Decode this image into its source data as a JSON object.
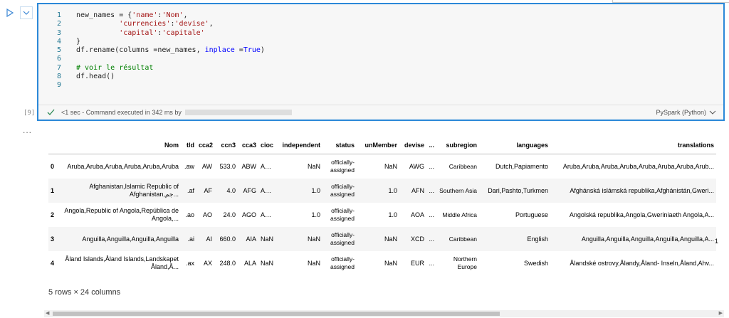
{
  "cell": {
    "exec_count": "[9]",
    "status_text": "<1 sec - Command executed in 342 ms by",
    "kernel": "PySpark (Python)",
    "more": "..."
  },
  "code": [
    [
      {
        "c": "p",
        "t": "new_names = {"
      },
      {
        "c": "s",
        "t": "'name'"
      },
      {
        "c": "p",
        "t": ":"
      },
      {
        "c": "s",
        "t": "'Nom'"
      },
      {
        "c": "p",
        "t": ","
      }
    ],
    [
      {
        "c": "p",
        "t": "          "
      },
      {
        "c": "s",
        "t": "'currencies'"
      },
      {
        "c": "p",
        "t": ":"
      },
      {
        "c": "s",
        "t": "'devise'"
      },
      {
        "c": "p",
        "t": ","
      }
    ],
    [
      {
        "c": "p",
        "t": "          "
      },
      {
        "c": "s",
        "t": "'capital'"
      },
      {
        "c": "p",
        "t": ":"
      },
      {
        "c": "s",
        "t": "'capitale'"
      }
    ],
    [
      {
        "c": "p",
        "t": "}"
      }
    ],
    [
      {
        "c": "p",
        "t": "df.rename(columns =new_names, "
      },
      {
        "c": "k",
        "t": "inplace"
      },
      {
        "c": "p",
        "t": " ="
      },
      {
        "c": "k",
        "t": "True"
      },
      {
        "c": "p",
        "t": ")"
      }
    ],
    [],
    [
      {
        "c": "m",
        "t": "# voir le résultat"
      }
    ],
    [
      {
        "c": "p",
        "t": "df.head()"
      }
    ],
    []
  ],
  "table": {
    "columns": [
      "",
      "Nom",
      "tld",
      "cca2",
      "ccn3",
      "cca3",
      "cioc",
      "independent",
      "status",
      "unMember",
      "devise",
      "...",
      "subregion",
      "languages",
      "translations"
    ],
    "rows": [
      [
        "0",
        "Aruba,Aruba,Aruba,Aruba,Aruba,Aruba",
        ".aw",
        "AW",
        "533.0",
        "ABW",
        "ARU",
        "NaN",
        "officially-assigned",
        "NaN",
        "AWG",
        "...",
        "Caribbean",
        "Dutch,Papiamento",
        "Aruba,Aruba,Aruba,Aruba,Aruba,Aruba,Aruba,Arub..."
      ],
      [
        "1",
        "Afghanistan,Islamic Republic of Afghanistan,جم...",
        ".af",
        "AF",
        "4.0",
        "AFG",
        "AFG",
        "1.0",
        "officially-assigned",
        "1.0",
        "AFN",
        "...",
        "Southern Asia",
        "Dari,Pashto,Turkmen",
        "Afghánská islámská republika,Afghánistán,Gweri..."
      ],
      [
        "2",
        "Angola,Republic of Angola,República de Angola,...",
        ".ao",
        "AO",
        "24.0",
        "AGO",
        "ANG",
        "1.0",
        "officially-assigned",
        "1.0",
        "AOA",
        "...",
        "Middle Africa",
        "Portuguese",
        "Angolská republika,Angola,Gweriniaeth Angola,A..."
      ],
      [
        "3",
        "Anguilla,Anguilla,Anguilla,Anguilla",
        ".ai",
        "AI",
        "660.0",
        "AIA",
        "NaN",
        "NaN",
        "officially-assigned",
        "NaN",
        "XCD",
        "...",
        "Caribbean",
        "English",
        "Anguilla,Anguilla,Anguilla,Anguilla,Anguilla,A..."
      ],
      [
        "4",
        "Åland Islands,Åland Islands,Landskapet Åland,Å...",
        ".ax",
        "AX",
        "248.0",
        "ALA",
        "NaN",
        "NaN",
        "officially-assigned",
        "NaN",
        "EUR",
        "...",
        "Northern Europe",
        "Swedish",
        "Ålandské ostrovy,Ålandy,Åland- Inseln,Åland,Ahv..."
      ]
    ],
    "overflow_digit": "1",
    "summary": "5 rows × 24 columns"
  },
  "icons": {
    "run": "play-icon",
    "collapse": "chevron-down-icon",
    "check": "check-icon",
    "kernel_dropdown": "chevron-down-icon",
    "scroll_left": "arrow-left-icon",
    "scroll_right": "arrow-right-icon"
  },
  "colors": {
    "accent": "#2b88d8",
    "string": "#a31515",
    "keyword": "#0000ff",
    "comment": "#008000",
    "success": "#2e8b57"
  }
}
